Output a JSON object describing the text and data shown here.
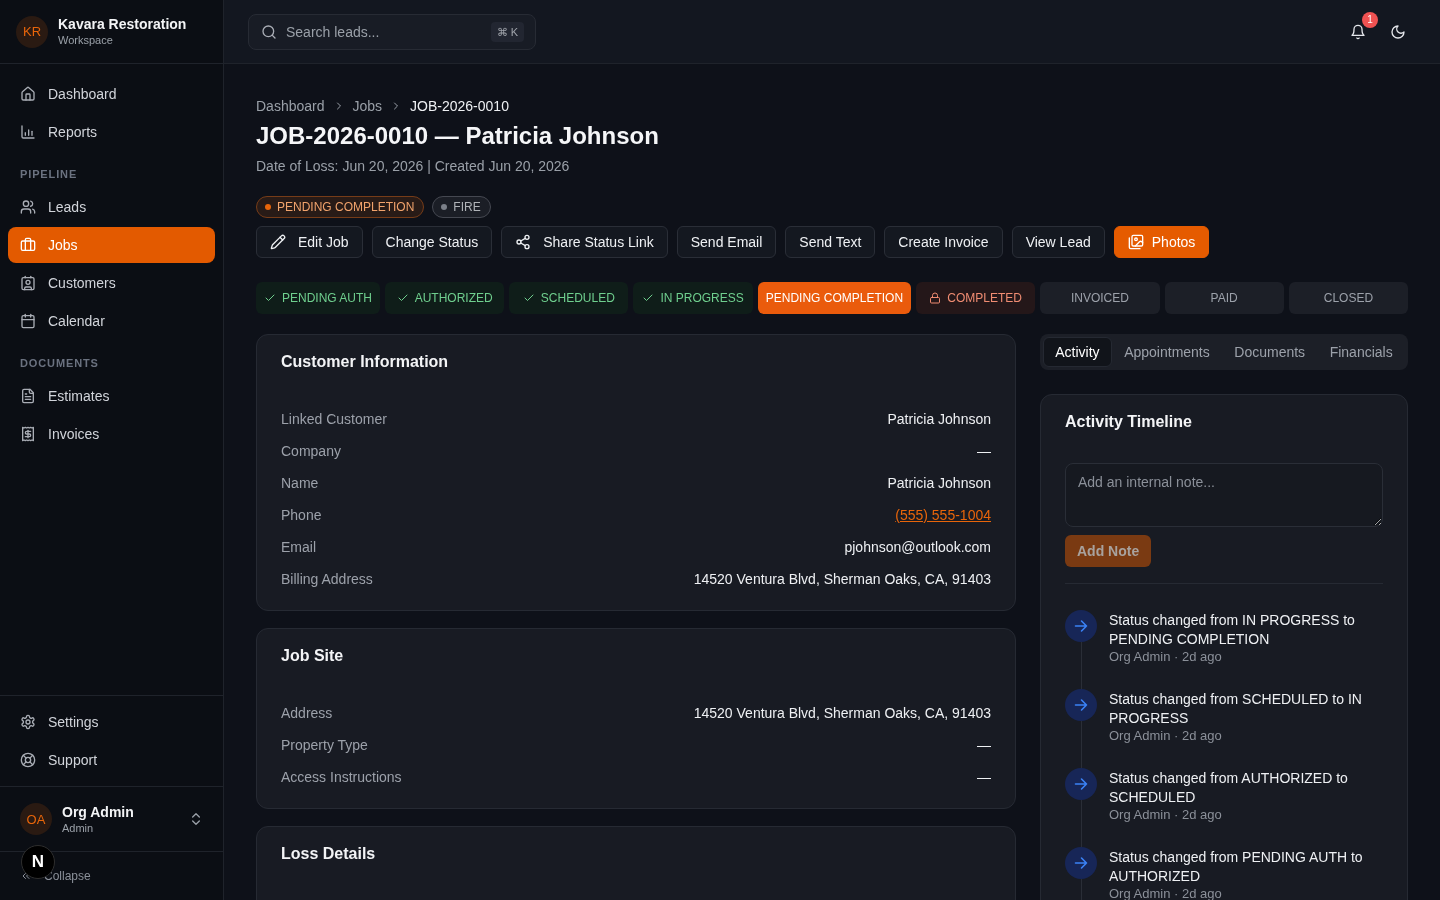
{
  "sidebar": {
    "workspace": {
      "initials": "KR",
      "name": "Kavara Restoration",
      "subtitle": "Workspace"
    },
    "groups": [
      {
        "items": [
          {
            "label": "Dashboard",
            "selected": false
          },
          {
            "label": "Reports",
            "selected": false
          }
        ]
      },
      {
        "heading": "PIPELINE",
        "items": [
          {
            "label": "Leads",
            "selected": false
          },
          {
            "label": "Jobs",
            "selected": true
          },
          {
            "label": "Customers",
            "selected": false
          },
          {
            "label": "Calendar",
            "selected": false
          }
        ]
      },
      {
        "heading": "DOCUMENTS",
        "items": [
          {
            "label": "Estimates",
            "selected": false
          },
          {
            "label": "Invoices",
            "selected": false
          }
        ]
      }
    ],
    "footer_items": [
      {
        "label": "Settings",
        "selected": false
      },
      {
        "label": "Support",
        "selected": false
      }
    ],
    "user": {
      "initials": "OA",
      "name": "Org Admin",
      "role": "Admin"
    },
    "collapse": {
      "label": "Collapse"
    }
  },
  "top_bar": {
    "search": {
      "placeholder": "Search leads...",
      "shortcut": "⌘ K"
    },
    "notifications": {
      "count": "1"
    }
  },
  "page": {
    "breadcrumb": [
      "Dashboard",
      "Jobs",
      "JOB-2026-0010"
    ],
    "title": "JOB-2026-0010 — Patricia Johnson",
    "subtitle": "Date of Loss: Jun 20, 2026 | Created Jun 20, 2026",
    "tags": [
      {
        "label": "PENDING COMPLETION",
        "color": "#e8650a"
      },
      {
        "label": "FIRE",
        "color": "#7b8089"
      }
    ],
    "actions": [
      {
        "label": "Edit Job",
        "kind": "secondary"
      },
      {
        "label": "Change Status",
        "kind": "secondary"
      },
      {
        "label": "Share Status Link",
        "kind": "secondary"
      },
      {
        "label": "Send Email",
        "kind": "secondary"
      },
      {
        "label": "Send Text",
        "kind": "secondary"
      },
      {
        "label": "Create Invoice",
        "kind": "secondary"
      },
      {
        "label": "View Lead",
        "kind": "secondary"
      },
      {
        "label": "Photos",
        "kind": "primary"
      }
    ],
    "pipeline": [
      {
        "label": "PENDING AUTH",
        "done": true,
        "current": false,
        "locked": false
      },
      {
        "label": "AUTHORIZED",
        "done": true,
        "current": false,
        "locked": false
      },
      {
        "label": "SCHEDULED",
        "done": true,
        "current": false,
        "locked": false
      },
      {
        "label": "IN PROGRESS",
        "done": true,
        "current": false,
        "locked": false
      },
      {
        "label": "PENDING COMPLETION",
        "done": false,
        "current": true,
        "locked": false
      },
      {
        "label": "COMPLETED",
        "done": false,
        "current": false,
        "locked": true
      },
      {
        "label": "INVOICED",
        "done": false,
        "current": false,
        "locked": false
      },
      {
        "label": "PAID",
        "done": false,
        "current": false,
        "locked": false
      },
      {
        "label": "CLOSED",
        "done": false,
        "current": false,
        "locked": false
      }
    ],
    "cards": [
      {
        "title": "Customer Information",
        "fields": [
          {
            "label": "Linked Customer",
            "value": "Patricia Johnson",
            "kind": "text"
          },
          {
            "label": "Company",
            "value": "—",
            "kind": "text"
          },
          {
            "label": "Name",
            "value": "Patricia Johnson",
            "kind": "text"
          },
          {
            "label": "Phone",
            "value": "(555) 555-1004",
            "kind": "link"
          },
          {
            "label": "Email",
            "value": "pjohnson@outlook.com",
            "kind": "text"
          },
          {
            "label": "Billing Address",
            "value": "14520 Ventura Blvd, Sherman Oaks, CA, 91403",
            "kind": "text"
          }
        ]
      },
      {
        "title": "Job Site",
        "fields": [
          {
            "label": "Address",
            "value": "14520 Ventura Blvd, Sherman Oaks, CA, 91403",
            "kind": "text"
          },
          {
            "label": "Property Type",
            "value": "—",
            "kind": "text"
          },
          {
            "label": "Access Instructions",
            "value": "—",
            "kind": "text"
          }
        ]
      },
      {
        "title": "Loss Details"
      }
    ]
  },
  "side_panel": {
    "tabs": [
      {
        "label": "Activity",
        "selected": true
      },
      {
        "label": "Appointments",
        "selected": false
      },
      {
        "label": "Documents",
        "selected": false
      },
      {
        "label": "Financials",
        "selected": false
      }
    ],
    "activity": {
      "title": "Activity Timeline",
      "note_field": {
        "placeholder": "Add an internal note..."
      },
      "add_note": {
        "label": "Add Note",
        "disabled": true
      },
      "events": [
        {
          "text": "Status changed from IN PROGRESS to PENDING COMPLETION",
          "meta": "Org Admin · 2d ago"
        },
        {
          "text": "Status changed from SCHEDULED to IN PROGRESS",
          "meta": "Org Admin · 2d ago"
        },
        {
          "text": "Status changed from AUTHORIZED to SCHEDULED",
          "meta": "Org Admin · 2d ago"
        },
        {
          "text": "Status changed from PENDING AUTH to AUTHORIZED",
          "meta": "Org Admin · 2d ago"
        }
      ]
    }
  },
  "dev_badge": {
    "label": "N"
  }
}
